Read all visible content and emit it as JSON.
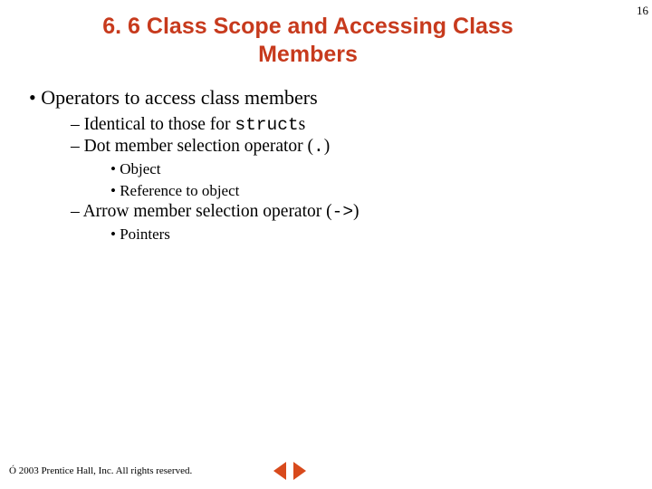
{
  "page_number": "16",
  "title_line1": "6. 6 Class Scope and Accessing Class",
  "title_line2": "Members",
  "bullets": {
    "l1_1": "Operators to access class members",
    "l2_1_pre": "Identical to those for ",
    "l2_1_code": "struct",
    "l2_1_post": "s",
    "l2_2_pre": "Dot member selection operator (",
    "l2_2_code": ".",
    "l2_2_post": ")",
    "l3_1": "Object",
    "l3_2": "Reference to object",
    "l2_3_pre": "Arrow member selection operator (",
    "l2_3_code": "->",
    "l2_3_post": ")",
    "l3_3": "Pointers"
  },
  "copyright": "Ó 2003 Prentice Hall, Inc.  All rights reserved."
}
